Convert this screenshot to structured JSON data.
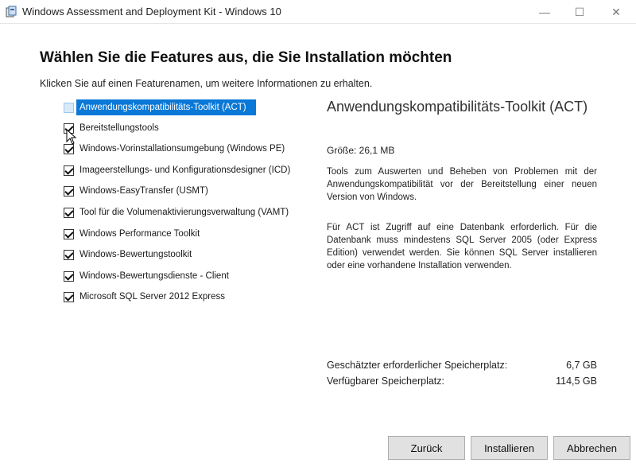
{
  "window": {
    "title": "Windows Assessment and Deployment Kit - Windows 10",
    "minimize_glyph": "—",
    "maximize_glyph": "☐",
    "close_glyph": "✕"
  },
  "page": {
    "heading": "Wählen Sie die Features aus, die Sie Installation möchten",
    "hint": "Klicken Sie auf einen Featurenamen, um weitere Informationen zu erhalten."
  },
  "features": [
    {
      "label": "Anwendungskompatibilitäts-Toolkit (ACT)",
      "checked": false,
      "selected": true
    },
    {
      "label": "Bereitstellungstools",
      "checked": true,
      "selected": false
    },
    {
      "label": "Windows-Vorinstallationsumgebung (Windows PE)",
      "checked": true,
      "selected": false
    },
    {
      "label": "Imageerstellungs- und Konfigurationsdesigner (ICD)",
      "checked": true,
      "selected": false
    },
    {
      "label": "Windows-EasyTransfer (USMT)",
      "checked": true,
      "selected": false
    },
    {
      "label": "Tool für die Volumenaktivierungsverwaltung (VAMT)",
      "checked": true,
      "selected": false
    },
    {
      "label": "Windows Performance Toolkit",
      "checked": true,
      "selected": false
    },
    {
      "label": "Windows-Bewertungstoolkit",
      "checked": true,
      "selected": false
    },
    {
      "label": "Windows-Bewertungsdienste - Client",
      "checked": true,
      "selected": false
    },
    {
      "label": "Microsoft SQL Server 2012 Express",
      "checked": true,
      "selected": false
    }
  ],
  "detail": {
    "title": "Anwendungskompatibilitäts-Toolkit (ACT)",
    "size": "Größe: 26,1 MB",
    "description_1": "Tools zum Auswerten und Beheben von Problemen mit der Anwendungskompatibilität vor der Bereitstellung einer neuen Version von Windows.",
    "description_2": "Für ACT ist Zugriff auf eine Datenbank erforderlich. Für die Datenbank muss mindestens SQL Server 2005 (oder Express Edition) verwendet werden. Sie können SQL Server installieren oder eine vorhandene Installation verwenden."
  },
  "space": {
    "required_label": "Geschätzter erforderlicher Speicherplatz:",
    "required_value": "6,7 GB",
    "available_label": "Verfügbarer Speicherplatz:",
    "available_value": "114,5 GB"
  },
  "buttons": {
    "back": "Zurück",
    "install": "Installieren",
    "cancel": "Abbrechen"
  },
  "colors": {
    "selection": "#0a78d7",
    "button_bg": "#e1e1e1"
  },
  "icons": [
    "installer-app-icon",
    "checkbox-icon",
    "mouse-cursor-icon"
  ]
}
